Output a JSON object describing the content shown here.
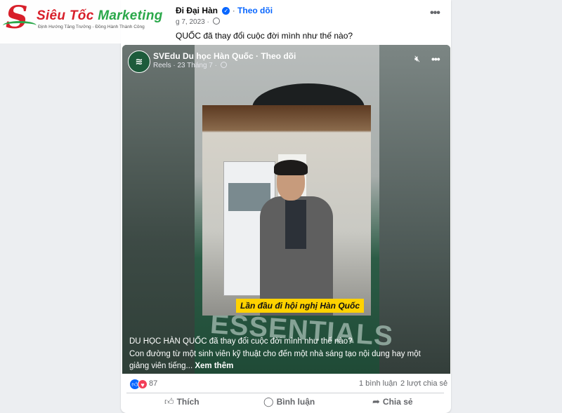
{
  "logo": {
    "name_part1": "Siêu Tốc",
    "name_part2": "Marketing",
    "tagline": "Định Hướng Tăng Trưởng - Đồng Hành Thành Công"
  },
  "post": {
    "author": "Đi Đại Hàn",
    "follow_label": "Theo dõi",
    "date": "g 7, 2023 ·",
    "text": "QUỐC đã thay đổi cuộc đời mình như thế nào?"
  },
  "video": {
    "page_name": "SVEdu Du học Hàn Quốc · Theo dõi",
    "meta": "Reels · 23 Tháng 7 ·",
    "photo_caption": "Lần đầu đi hội nghị Hàn Quốc",
    "shirt_text": "ESSENTIALS",
    "caption_line1": "DU HỌC HÀN QUỐC đã thay đổi cuộc đời mình như thế nào?",
    "caption_line2": "Con đường từ một sinh viên kỹ thuật cho đến một nhà sáng tạo nội dung hay một",
    "caption_line3": "giảng viên tiếng...",
    "see_more": "Xem thêm"
  },
  "stats": {
    "reaction_count": "87",
    "comments": "1 bình luận",
    "shares": "2 lượt chia sẻ"
  },
  "actions": {
    "like": "Thích",
    "comment": "Bình luận",
    "share": "Chia sẻ"
  },
  "icons": {
    "verified": "verified-badge-icon",
    "globe": "globe-icon",
    "mute": "speaker-muted-icon",
    "more": "more-dots-icon"
  },
  "colors": {
    "facebook_blue": "#0866ff",
    "love_red": "#f33e58",
    "logo_red": "#d81f2a",
    "logo_green": "#2aa84a",
    "caption_yellow": "#ffd200"
  }
}
